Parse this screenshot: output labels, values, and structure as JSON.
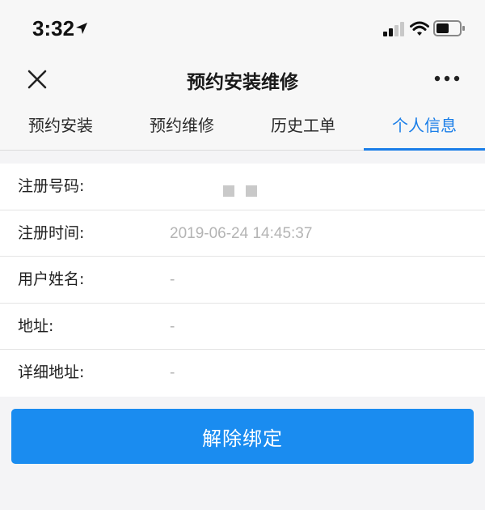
{
  "status_bar": {
    "time": "3:32",
    "icons": [
      "location-arrow-icon",
      "cellular-signal-icon",
      "wifi-icon",
      "battery-icon"
    ]
  },
  "nav": {
    "title": "预约安装维修",
    "left_icon": "close-icon",
    "right_icon": "more-icon"
  },
  "tabs": [
    {
      "label": "预约安装",
      "active": false
    },
    {
      "label": "预约维修",
      "active": false
    },
    {
      "label": "历史工单",
      "active": false
    },
    {
      "label": "个人信息",
      "active": true
    }
  ],
  "info": {
    "registration_number": {
      "label": "注册号码:",
      "value": "▪ ▪"
    },
    "registration_time": {
      "label": "注册时间:",
      "value": "2019-06-24 14:45:37"
    },
    "user_name": {
      "label": "用户姓名:",
      "value": "-"
    },
    "address": {
      "label": "地址:",
      "value": "-"
    },
    "detail_address": {
      "label": "详细地址:",
      "value": "-"
    }
  },
  "actions": {
    "unbind_label": "解除绑定"
  },
  "colors": {
    "accent": "#1a7ee8",
    "button": "#1a8cf0",
    "muted_text": "#b4b4b4",
    "page_background": "#f4f4f6"
  }
}
